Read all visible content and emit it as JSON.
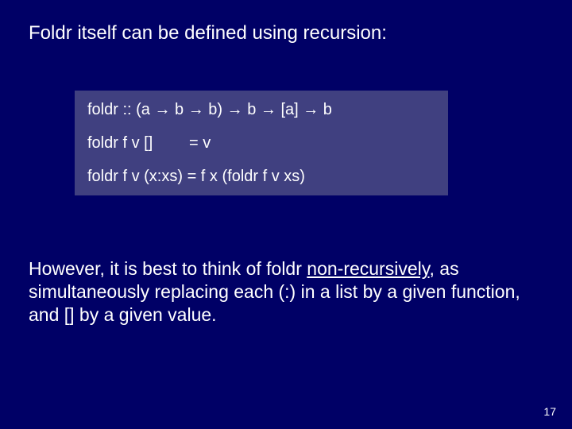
{
  "heading": "Foldr itself can be defined using recursion:",
  "code": {
    "line1_a": "foldr :: (a ",
    "line1_b": " b ",
    "line1_c": " b) ",
    "line1_d": " b ",
    "line1_e": " [a] ",
    "line1_f": " b",
    "arrow": "→",
    "line2_left": "foldr f v []",
    "line2_right": "= v",
    "line3": "foldr f v (x:xs) = f x (foldr f v xs)"
  },
  "body": {
    "part1": "However, it is best to think of foldr ",
    "underlined": "non-recursively",
    "part2": ", as simultaneously replacing each (:) in a list by a given function, and [] by a given value."
  },
  "page_number": "17"
}
